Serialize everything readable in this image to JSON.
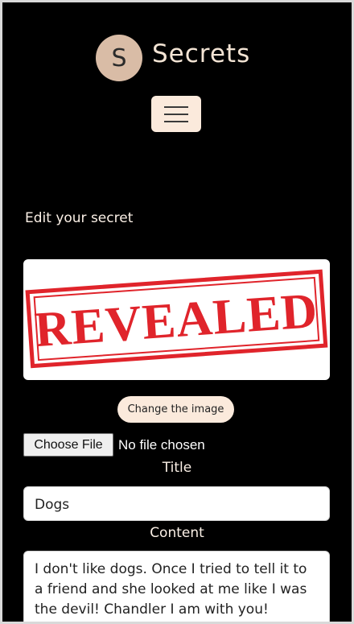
{
  "header": {
    "logo_letter": "S",
    "brand": "Secrets",
    "menu_icon": "hamburger-icon"
  },
  "page": {
    "heading": "Edit your secret"
  },
  "image": {
    "stamp_text": "REVEALED",
    "stamp_color": "#e0242b",
    "change_button": "Change the image"
  },
  "file_input": {
    "button_label": "Choose File",
    "status": "No file chosen"
  },
  "form": {
    "title_label": "Title",
    "title_value": "Dogs",
    "content_label": "Content",
    "content_value": "I don't like dogs. Once I tried to tell it to a friend and she looked at me like I was the devil! Chandler I am with you!"
  },
  "colors": {
    "background": "#000000",
    "accent": "#fbeadc",
    "logo_circle": "#d9bca6"
  }
}
